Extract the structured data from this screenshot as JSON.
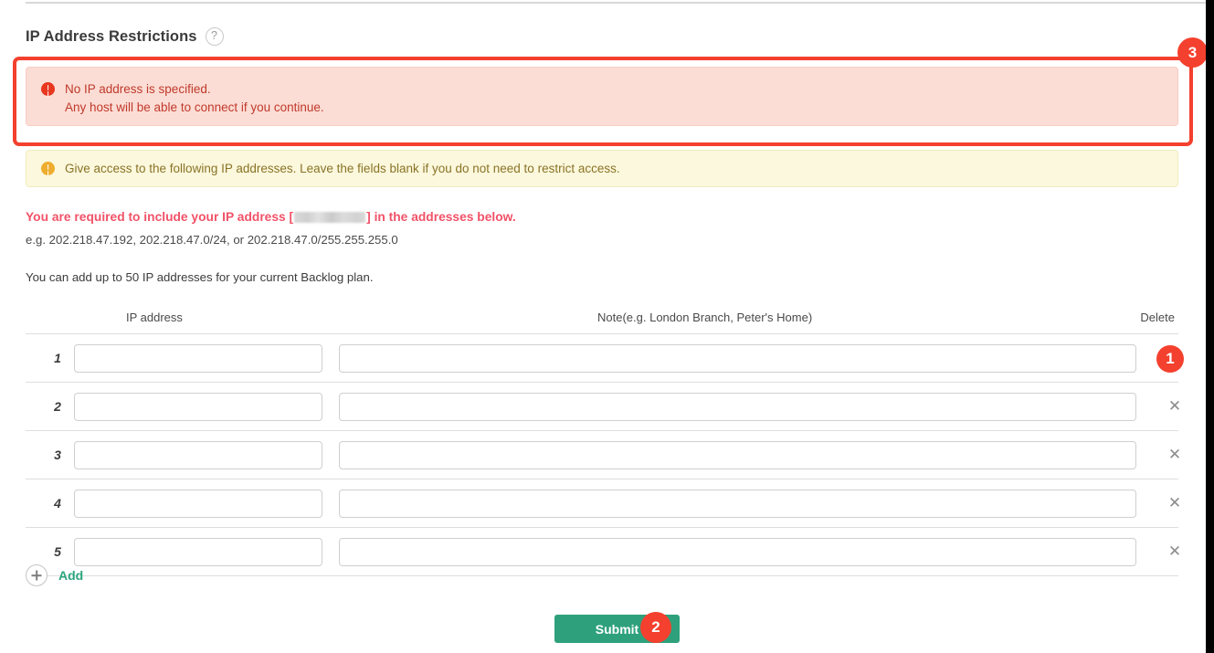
{
  "section": {
    "title": "IP Address Restrictions",
    "help_icon": "question-mark-icon"
  },
  "alerts": {
    "danger": {
      "icon": "exclamation-circle-icon",
      "line1": "No IP address is specified.",
      "line2": "Any host will be able to connect if you continue.",
      "color": "#c0392b",
      "background": "#fbddd5"
    },
    "warning": {
      "icon": "exclamation-circle-icon",
      "text": "Give access to the following IP addresses. Leave the fields blank if you do not need to restrict access.",
      "color": "#8a7326",
      "background": "#fbf8dd"
    }
  },
  "notes": {
    "required_prefix": "You are required to include your IP address [",
    "required_suffix": "] in the addresses below.",
    "required_color": "#f25268",
    "example": "e.g. 202.218.47.192, 202.218.47.0/24, or 202.218.47.0/255.255.255.0",
    "plan_limit": "You can add up to 50 IP addresses for your current Backlog plan."
  },
  "table": {
    "headers": {
      "ip": "IP address",
      "note": "Note(e.g. London Branch, Peter's Home)",
      "delete": "Delete"
    },
    "rows": [
      {
        "num": "1",
        "ip": "",
        "note": "",
        "ip_placeholder": "",
        "note_placeholder": "",
        "delete_icon": "close-x-icon"
      },
      {
        "num": "2",
        "ip": "",
        "note": "",
        "ip_placeholder": "",
        "note_placeholder": "",
        "delete_icon": "close-x-icon"
      },
      {
        "num": "3",
        "ip": "",
        "note": "",
        "ip_placeholder": "",
        "note_placeholder": "",
        "delete_icon": "close-x-icon"
      },
      {
        "num": "4",
        "ip": "",
        "note": "",
        "ip_placeholder": "",
        "note_placeholder": "",
        "delete_icon": "close-x-icon"
      },
      {
        "num": "5",
        "ip": "",
        "note": "",
        "ip_placeholder": "",
        "note_placeholder": "",
        "delete_icon": "close-x-icon"
      }
    ]
  },
  "add": {
    "icon": "plus-circle-icon",
    "label": "Add",
    "color": "#2ca57f"
  },
  "submit": {
    "label": "Submit",
    "color": "#2ea17c"
  },
  "annotations": {
    "badge1": "1",
    "badge2": "2",
    "badge3": "3",
    "color": "#f4402e"
  }
}
